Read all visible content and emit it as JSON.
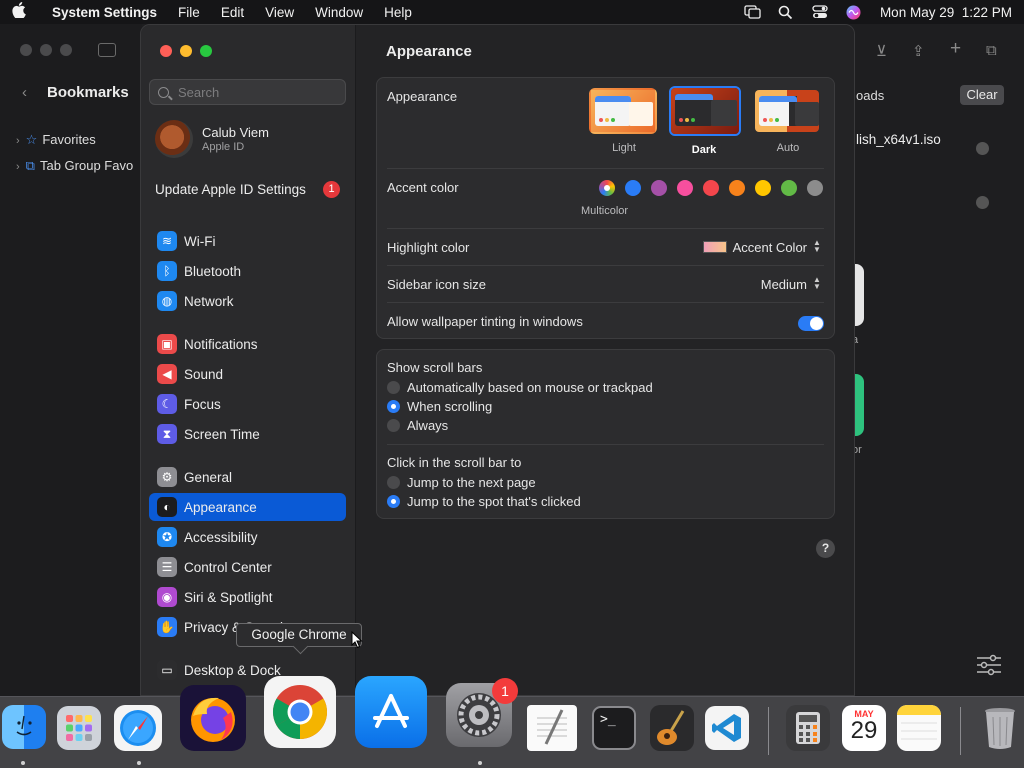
{
  "menubar": {
    "app_name": "System Settings",
    "menus": [
      "File",
      "Edit",
      "View",
      "Window",
      "Help"
    ],
    "clock": "Mon May 29  1:22 PM"
  },
  "background_window": {
    "title": "Bookmarks",
    "tree": [
      "Favorites",
      "Tab Group Favo"
    ],
    "downloads_label": "oads",
    "clear_label": "Clear",
    "file_name": "lish_x64v1.iso",
    "partial_labels": [
      "a",
      "or"
    ]
  },
  "sidebar": {
    "search_placeholder": "Search",
    "user_name": "Calub Viem",
    "user_sub": "Apple ID",
    "update_label": "Update Apple ID Settings",
    "update_badge": "1",
    "items": [
      {
        "label": "Wi-Fi",
        "color": "#1e88f0",
        "glyph": "≋"
      },
      {
        "label": "Bluetooth",
        "color": "#1e88f0",
        "glyph": "ᛒ"
      },
      {
        "label": "Network",
        "color": "#1e88f0",
        "glyph": "◍"
      },
      {
        "label": "Notifications",
        "color": "#eb4a4a",
        "glyph": "▣"
      },
      {
        "label": "Sound",
        "color": "#eb4a4a",
        "glyph": "◀"
      },
      {
        "label": "Focus",
        "color": "#5e5ce6",
        "glyph": "☾"
      },
      {
        "label": "Screen Time",
        "color": "#5e5ce6",
        "glyph": "⧗"
      },
      {
        "label": "General",
        "color": "#8e8e93",
        "glyph": "⚙"
      },
      {
        "label": "Appearance",
        "color": "#1c1c1e",
        "glyph": "◐"
      },
      {
        "label": "Accessibility",
        "color": "#1e88f0",
        "glyph": "✪"
      },
      {
        "label": "Control Center",
        "color": "#8e8e93",
        "glyph": "☰"
      },
      {
        "label": "Siri & Spotlight",
        "color": "#b04ad0",
        "glyph": "◉"
      },
      {
        "label": "Privacy & Security",
        "color": "#2a7cf6",
        "glyph": "✋"
      },
      {
        "label": "Desktop & Dock",
        "color": "#2c2c2e",
        "glyph": "▭"
      }
    ]
  },
  "main": {
    "title": "Appearance",
    "appearance_label": "Appearance",
    "themes": [
      "Light",
      "Dark",
      "Auto"
    ],
    "selected_theme": "Dark",
    "accent_label": "Accent color",
    "accent_colors": [
      "#2a7cf6",
      "#a550a7",
      "#f74f9e",
      "#f3464c",
      "#f7821b",
      "#ffc600",
      "#62ba46",
      "#8c8c8c"
    ],
    "accent_selected_label": "Multicolor",
    "highlight_label": "Highlight color",
    "highlight_value": "Accent Color",
    "sidebar_icon_label": "Sidebar icon size",
    "sidebar_icon_value": "Medium",
    "tinting_label": "Allow wallpaper tinting in windows",
    "tinting_on": true,
    "scroll_bars_label": "Show scroll bars",
    "scroll_options": [
      "Automatically based on mouse or trackpad",
      "When scrolling",
      "Always"
    ],
    "scroll_selected": "When scrolling",
    "click_label": "Click in the scroll bar to",
    "click_options": [
      "Jump to the next page",
      "Jump to the spot that's clicked"
    ],
    "click_selected": "Jump to the spot that's clicked",
    "help": "?"
  },
  "tooltip": "Google Chrome",
  "dock": {
    "calendar_month": "MAY",
    "calendar_day": "29",
    "settings_badge": "1"
  }
}
